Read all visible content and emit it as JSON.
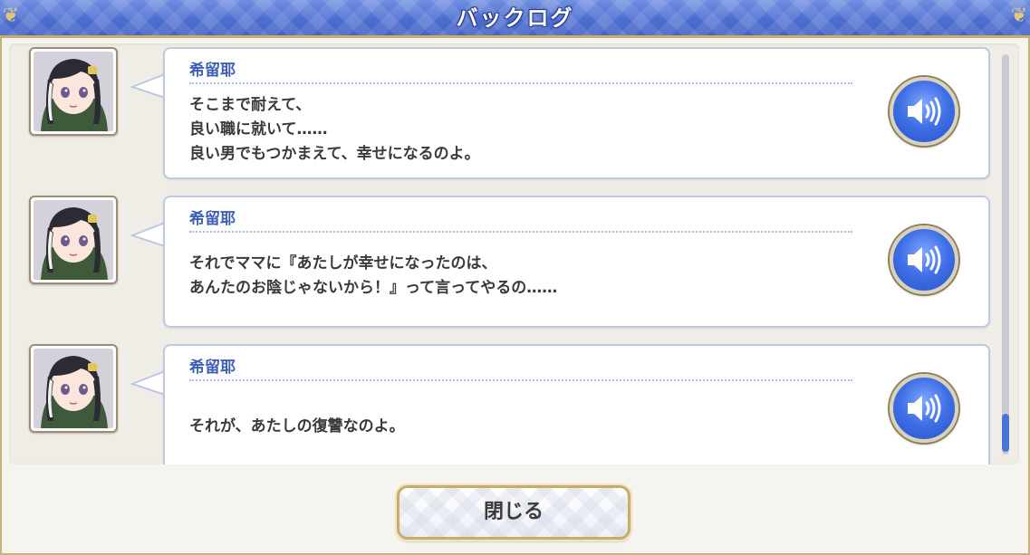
{
  "header": {
    "title": "バックログ"
  },
  "entries": [
    {
      "speaker": "希留耶",
      "lines": [
        "そこまで耐えて、",
        "良い職に就いて……",
        "良い男でもつかまえて、幸せになるのよ。"
      ]
    },
    {
      "speaker": "希留耶",
      "lines": [
        "それでママに『あたしが幸せになったのは、",
        "あんたのお陰じゃないから！』って言ってやるの……"
      ]
    },
    {
      "speaker": "希留耶",
      "lines": [
        "それが、あたしの復讐なのよ。"
      ]
    }
  ],
  "icons": {
    "voice": "speaker-volume-icon",
    "corner": "ornament-icon"
  },
  "footer": {
    "close_label": "閉じる"
  },
  "colors": {
    "header_blue": "#4d6ed1",
    "accent_gold": "#c9ad63",
    "speaker_blue": "#3d5fb3",
    "voice_blue": "#3f6fe6"
  }
}
